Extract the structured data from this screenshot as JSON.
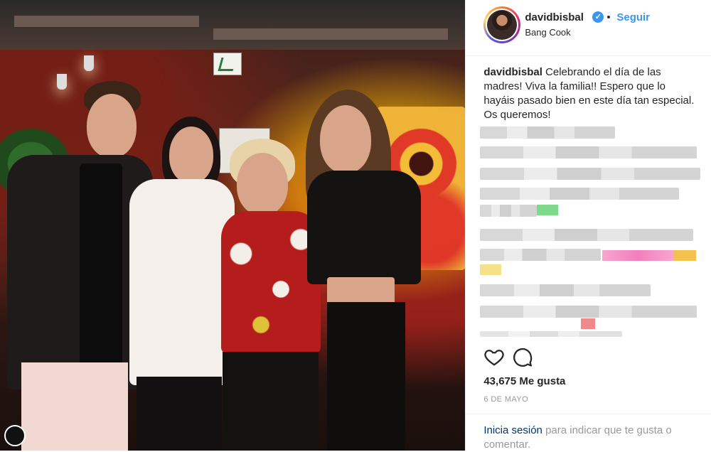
{
  "post": {
    "username": "davidbisbal",
    "verified_glyph": "✓",
    "separator": "•",
    "follow_label": "Seguir",
    "location": "Bang Cook",
    "caption_user": "davidbisbal",
    "caption_text": "Celebrando el día de las madres! Viva la familia!! Espero que lo hayáis pasado bien en este día tan especial. Os queremos!",
    "likes_label": "43,675 Me gusta",
    "date_label": "6 DE MAYO",
    "login_link": "Inicia sesión",
    "login_rest": "para indicar que te gusta o comentar."
  },
  "icons": {
    "like": "heart-outline-icon",
    "comment": "comment-bubble-icon",
    "verified": "verified-badge-icon"
  },
  "colors": {
    "accent_blue": "#3897f0",
    "link_dark": "#003569",
    "text": "#262626",
    "muted": "#999999",
    "border": "#efefef"
  }
}
